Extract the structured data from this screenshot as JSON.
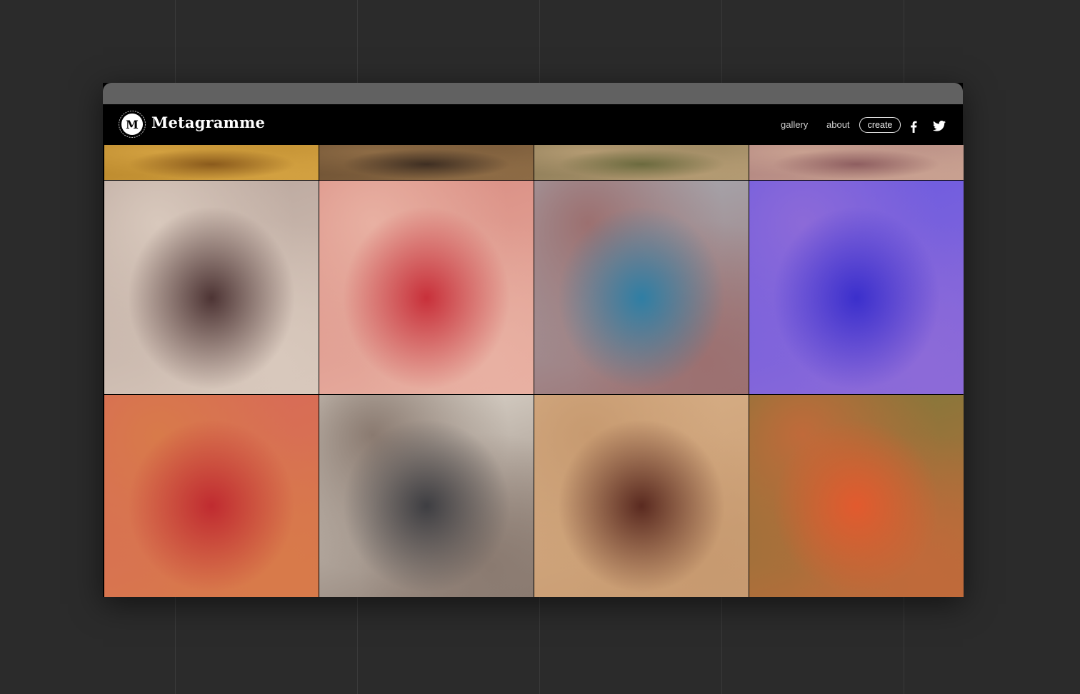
{
  "brand": {
    "name": "Metagramme",
    "logo_letter": "M"
  },
  "nav": {
    "gallery_label": "gallery",
    "about_label": "about",
    "create_label": "create"
  },
  "icons": {
    "facebook": "facebook-icon",
    "twitter": "twitter-icon"
  },
  "colors": {
    "page_bg": "#2b2b2b",
    "titlebar": "#616161",
    "navbar": "#000000"
  },
  "gallery": {
    "tiles": [
      {
        "c1": "#b8862a",
        "c2": "#8a5a1c",
        "c3": "#d2a040"
      },
      {
        "c1": "#6b4f32",
        "c2": "#3e2e22",
        "c3": "#8d6b45"
      },
      {
        "c1": "#8a7a55",
        "c2": "#6b6a3e",
        "c3": "#b39a72"
      },
      {
        "c1": "#b08480",
        "c2": "#8e5e60",
        "c3": "#c8a090"
      },
      {
        "c1": "#b7a39a",
        "c2": "#4d3434",
        "c3": "#d8c8bc"
      },
      {
        "c1": "#d88a80",
        "c2": "#c8303a",
        "c3": "#e8b0a2"
      },
      {
        "c1": "#a8b0b8",
        "c2": "#2f7ea4",
        "c3": "#9c7070"
      },
      {
        "c1": "#6a5ae0",
        "c2": "#3b2fcc",
        "c3": "#8c6ad8"
      },
      {
        "c1": "#d8685a",
        "c2": "#c02b30",
        "c3": "#d87a4a"
      },
      {
        "c1": "#e6e0d6",
        "c2": "#3e3e42",
        "c3": "#8a7a70"
      },
      {
        "c1": "#d8b088",
        "c2": "#5a2a20",
        "c3": "#c79a70"
      },
      {
        "c1": "#7a7a3a",
        "c2": "#e25a2e",
        "c3": "#c06a3a"
      }
    ]
  }
}
